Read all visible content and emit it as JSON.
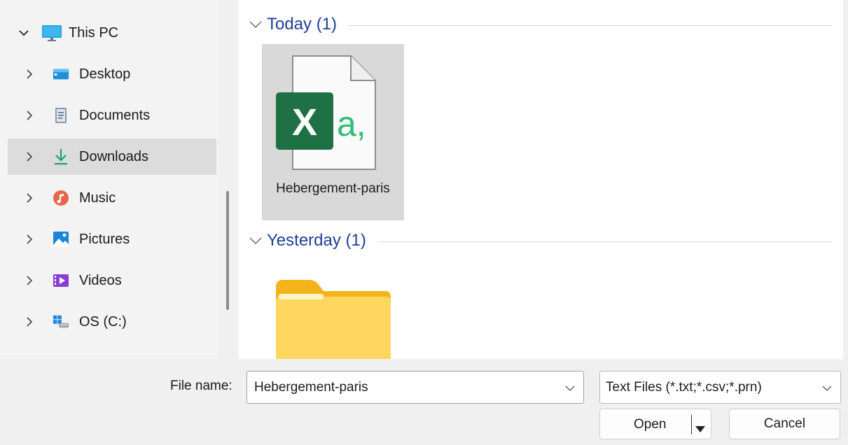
{
  "navigation": {
    "items": [
      {
        "label": "This PC",
        "icon": "monitor-icon",
        "expanded": true
      },
      {
        "label": "Desktop",
        "icon": "desktop-folder-icon"
      },
      {
        "label": "Documents",
        "icon": "documents-icon"
      },
      {
        "label": "Downloads",
        "icon": "download-arrow-icon",
        "selected": true
      },
      {
        "label": "Music",
        "icon": "music-icon"
      },
      {
        "label": "Pictures",
        "icon": "pictures-icon"
      },
      {
        "label": "Videos",
        "icon": "videos-icon"
      },
      {
        "label": "OS (C:)",
        "icon": "drive-icon"
      }
    ]
  },
  "content": {
    "groups": [
      {
        "title": "Today (1)",
        "files": [
          {
            "name": "Hebergement-paris",
            "icon": "excel-csv-icon",
            "selected": true
          }
        ]
      },
      {
        "title": "Yesterday (1)",
        "files": [
          {
            "name": "",
            "icon": "folder-icon"
          }
        ]
      }
    ]
  },
  "bottom_bar": {
    "file_name_label": "File name:",
    "file_name_value": "Hebergement-paris",
    "file_type": "Text Files (*.txt;*.csv;*.prn)",
    "open_label": "Open",
    "cancel_label": "Cancel"
  },
  "colors": {
    "group_title": "#1f3f99",
    "excel_green": "#1e7145",
    "selection": "#d9d9d9"
  }
}
